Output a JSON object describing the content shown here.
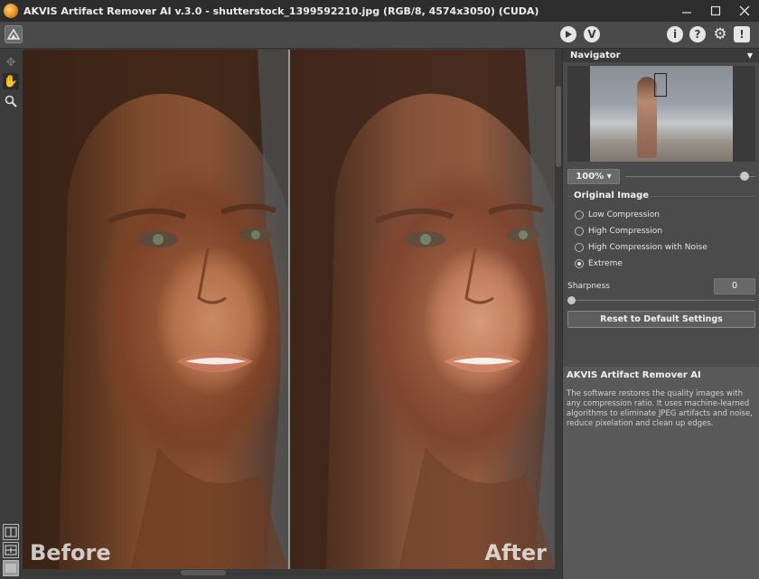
{
  "window": {
    "title": "AKVIS Artifact Remover AI v.3.0 - shutterstock_1399592210.jpg (RGB/8, 4574x3050) (CUDA)",
    "minimize_icon": "minimize-icon",
    "maximize_icon": "maximize-icon",
    "close_icon": "close-icon"
  },
  "toolbar": {
    "run_icon": "play-icon",
    "apply_label": "V",
    "info_label": "i",
    "help_label": "?",
    "settings_icon": "gear-icon",
    "feedback_label": "!"
  },
  "tools": [
    "hand-icon",
    "zoom-icon",
    "split-view-icon",
    "compare-view-icon",
    "single-view-icon"
  ],
  "canvas": {
    "before_label": "Before",
    "after_label": "After"
  },
  "navigator": {
    "title": "Navigator",
    "zoom_value": "100%",
    "zoom_slider_level": 0.92
  },
  "settings": {
    "group_title": "Original Image",
    "options": [
      {
        "label": "Low Compression",
        "checked": false
      },
      {
        "label": "High Compression",
        "checked": false
      },
      {
        "label": "High Compression with Noise",
        "checked": false
      },
      {
        "label": "Extreme",
        "checked": true
      }
    ],
    "sharpness_label": "Sharpness",
    "sharpness_value": "0",
    "reset_label": "Reset to Default Settings"
  },
  "help": {
    "title": "AKVIS Artifact Remover AI",
    "text": "The software restores the quality images with any compression ratio. It uses machine-learned algorithms to eliminate JPEG artifacts and noise, reduce pixelation and clean up edges."
  }
}
